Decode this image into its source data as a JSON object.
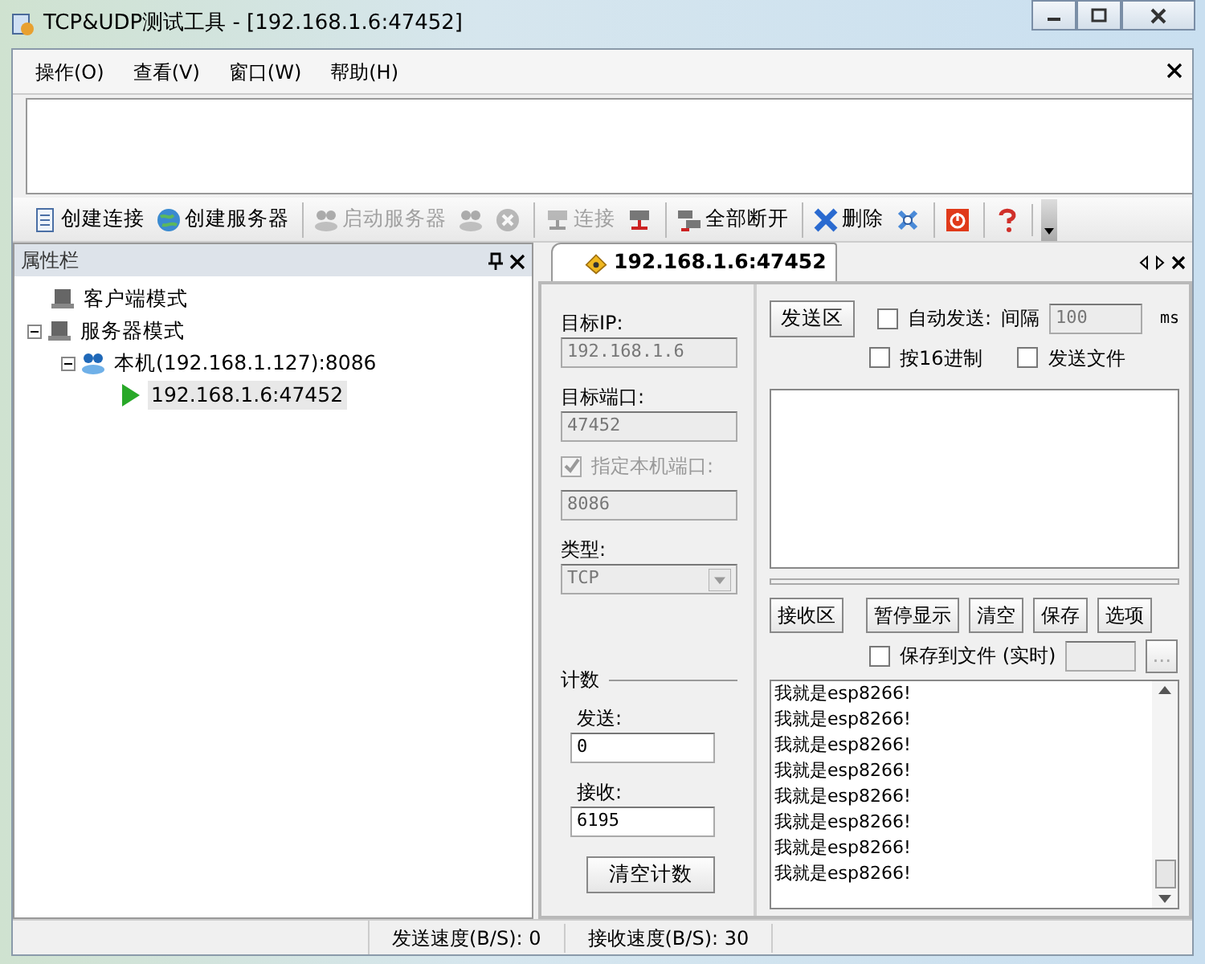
{
  "window": {
    "title": "TCP&UDP测试工具 - [192.168.1.6:47452]"
  },
  "menu": [
    "操作(O)",
    "查看(V)",
    "窗口(W)",
    "帮助(H)"
  ],
  "toolbar": [
    {
      "label": "创建连接",
      "disabled": false,
      "separator_before": false
    },
    {
      "label": "创建服务器",
      "disabled": false,
      "separator_before": false
    },
    {
      "label": "启动服务器",
      "disabled": true,
      "separator_before": true
    },
    {
      "disabled": true,
      "separator_before": false
    },
    {
      "disabled": true,
      "separator_before": false
    },
    {
      "label": "连接",
      "disabled": true,
      "separator_before": true
    },
    {
      "disabled": false,
      "separator_before": false
    },
    {
      "label": "全部断开",
      "disabled": false,
      "separator_before": true
    },
    {
      "label": "删除",
      "disabled": false,
      "separator_before": true
    },
    {
      "disabled": false,
      "separator_before": false
    },
    {
      "disabled": false,
      "separator_before": true
    },
    {
      "disabled": false,
      "separator_before": true
    }
  ],
  "property_panel": {
    "title": "属性栏",
    "tree": [
      {
        "label": "客户端模式",
        "kind": "mode",
        "selected": false
      },
      {
        "label": "服务器模式",
        "kind": "mode",
        "selected": false,
        "expanded": true,
        "children": [
          {
            "label": "本机(192.168.1.127):8086",
            "kind": "host",
            "selected": false,
            "expanded": true,
            "children": [
              {
                "label": "192.168.1.6:47452",
                "kind": "connection",
                "selected": true
              }
            ]
          }
        ]
      }
    ]
  },
  "tabs": [
    {
      "label": "192.168.1.6:47452",
      "selected": true
    }
  ],
  "connection": {
    "target_ip_label": "目标IP:",
    "target_ip": "192.168.1.6",
    "target_ip_disabled": true,
    "target_port_label": "目标端口:",
    "target_port": "47452",
    "target_port_disabled": true,
    "local_port_label": "指定本机端口:",
    "local_port_checked": true,
    "local_port_disabled": true,
    "local_port": "8086",
    "type_label": "类型:",
    "type": "TCP",
    "type_disabled": true
  },
  "counter": {
    "title": "计数",
    "sent_label": "发送:",
    "sent": "0",
    "received_label": "接收:",
    "received": "6195",
    "clear_button": "清空计数"
  },
  "send": {
    "button": "发送区",
    "auto_send_label": "自动发送:",
    "auto_send_checked": false,
    "interval_label": "间隔",
    "interval": "100",
    "interval_disabled": true,
    "unit": "ms",
    "hex_label": "按16进制",
    "hex_checked": false,
    "file_label": "发送文件",
    "file_checked": false
  },
  "receive": {
    "button": "接收区",
    "buttons": [
      "暂停显示",
      "清空",
      "保存",
      "选项"
    ],
    "save_file_label": "保存到文件 (实时)",
    "save_file_checked": false,
    "browse_button": "...",
    "lines": [
      "我就是esp8266!",
      "我就是esp8266!",
      "我就是esp8266!",
      "我就是esp8266!",
      "我就是esp8266!",
      "我就是esp8266!",
      "我就是esp8266!",
      "我就是esp8266!"
    ]
  },
  "status_bar": [
    "发送速度(B/S): 0",
    "接收速度(B/S): 30"
  ]
}
